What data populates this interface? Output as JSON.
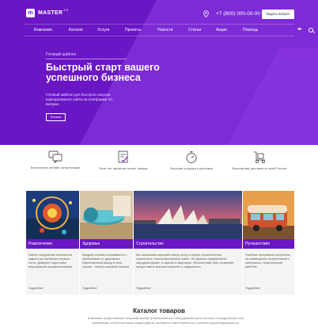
{
  "header": {
    "logo_mark": "m",
    "logo_text": "MASTER",
    "logo_version": "2.0",
    "phone": "+7 (800) 000-00-00",
    "ask_button": "Задать вопрос"
  },
  "nav": {
    "items": [
      "Компания",
      "Каталог",
      "Услуги",
      "Проекты",
      "Новости",
      "Статьи",
      "Акции",
      "Помощь"
    ],
    "more": "•••"
  },
  "hero": {
    "eyebrow": "Готовый шаблон",
    "title": "Быстрый старт вашего успешного бизнеса",
    "lead": "Готовый шаблон для быстрого запуска корпоративного сайта на платформе 1С-Битрикс",
    "button": "Кнопка"
  },
  "features": [
    {
      "icon": "chat-icon",
      "label": "Бесплатная онлайн консультация"
    },
    {
      "icon": "document-check-icon",
      "label": "Пять лет гарантии на все товары"
    },
    {
      "icon": "stopwatch-icon",
      "label": "Быстрая отгрузка и доставка"
    },
    {
      "icon": "truck-icon",
      "label": "Бесплатная доставка по всей России"
    }
  ],
  "cards": [
    {
      "title": "Развлечения",
      "text": "Любое сооружение начинается задолго до прибытия первого гостя. Доверьте подготовку мероприятия профессионалам.",
      "more": "Подробнее"
    },
    {
      "title": "Здоровье",
      "text": "Каждый человек сталкивается с проблемами со здоровьем. Единственный выход в этом случае – выбор хорошей клиники.",
      "more": "Подробнее"
    },
    {
      "title": "Строительство",
      "text": "Мы оказываем широкий спектр услуг в сфере строительства, отделочных, электромонтажных работ. Не крупных предприятий, затрудняя домах, в офисах и квартирах. Многолетний опыт позволяет предоставить высокое качество и надежность.",
      "more": "Подробнее"
    },
    {
      "title": "Путешествия",
      "text": "Учебные программы построены на совмещении теоретического материала с практической работой.",
      "more": "Подробнее"
    }
  ],
  "catalog": {
    "title": "Каталог товаров",
    "text": "Компания предоставляет широкий выбор промышленного оборудования для частных и юридических лиц. Ключевыми особенностями нашей работы являются ответственность и клиентоориентированность."
  },
  "colors": {
    "brand": "#6a16c4",
    "card_bg": "#f4f4f6"
  }
}
